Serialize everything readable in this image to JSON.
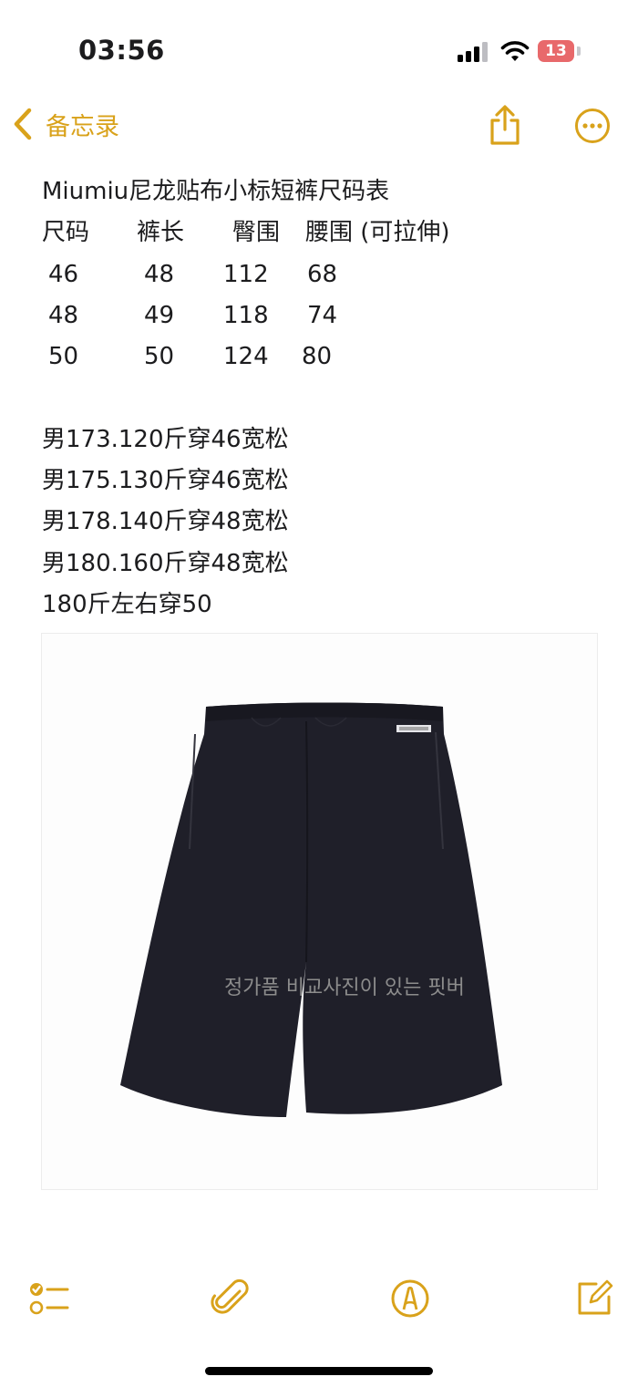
{
  "status_bar": {
    "time": "03:56",
    "battery_level": "13",
    "battery_color": "#e8696b"
  },
  "nav": {
    "back_label": "备忘录",
    "back_icon": "chevron-left-icon",
    "share_icon": "share-icon",
    "more_icon": "ellipsis-circle-icon",
    "accent_color": "#d9a21b"
  },
  "note": {
    "title": "Miumiu尼龙贴布小标短裤尺码表",
    "size_table": {
      "headers": [
        "尺码",
        "裤长",
        "臀围",
        "腰围 (可拉伸)"
      ],
      "rows": [
        [
          "46",
          "48",
          "112",
          "68"
        ],
        [
          "48",
          "49",
          "118",
          "74"
        ],
        [
          "50",
          "50",
          "124",
          "80"
        ]
      ]
    },
    "fit_lines": [
      "男173.120斤穿46宽松",
      "男175.130斤穿46宽松",
      "男178.140斤穿48宽松",
      "男180.160斤穿48宽松",
      "180斤左右穿50"
    ]
  },
  "photo": {
    "watermark": "정가품 비교사진이 있는 핏버",
    "garment_color": "#1f1f29"
  },
  "toolbar": {
    "checklist_icon": "checklist-icon",
    "attachment_icon": "paperclip-icon",
    "markup_icon": "markup-pen-icon",
    "compose_icon": "compose-icon"
  }
}
